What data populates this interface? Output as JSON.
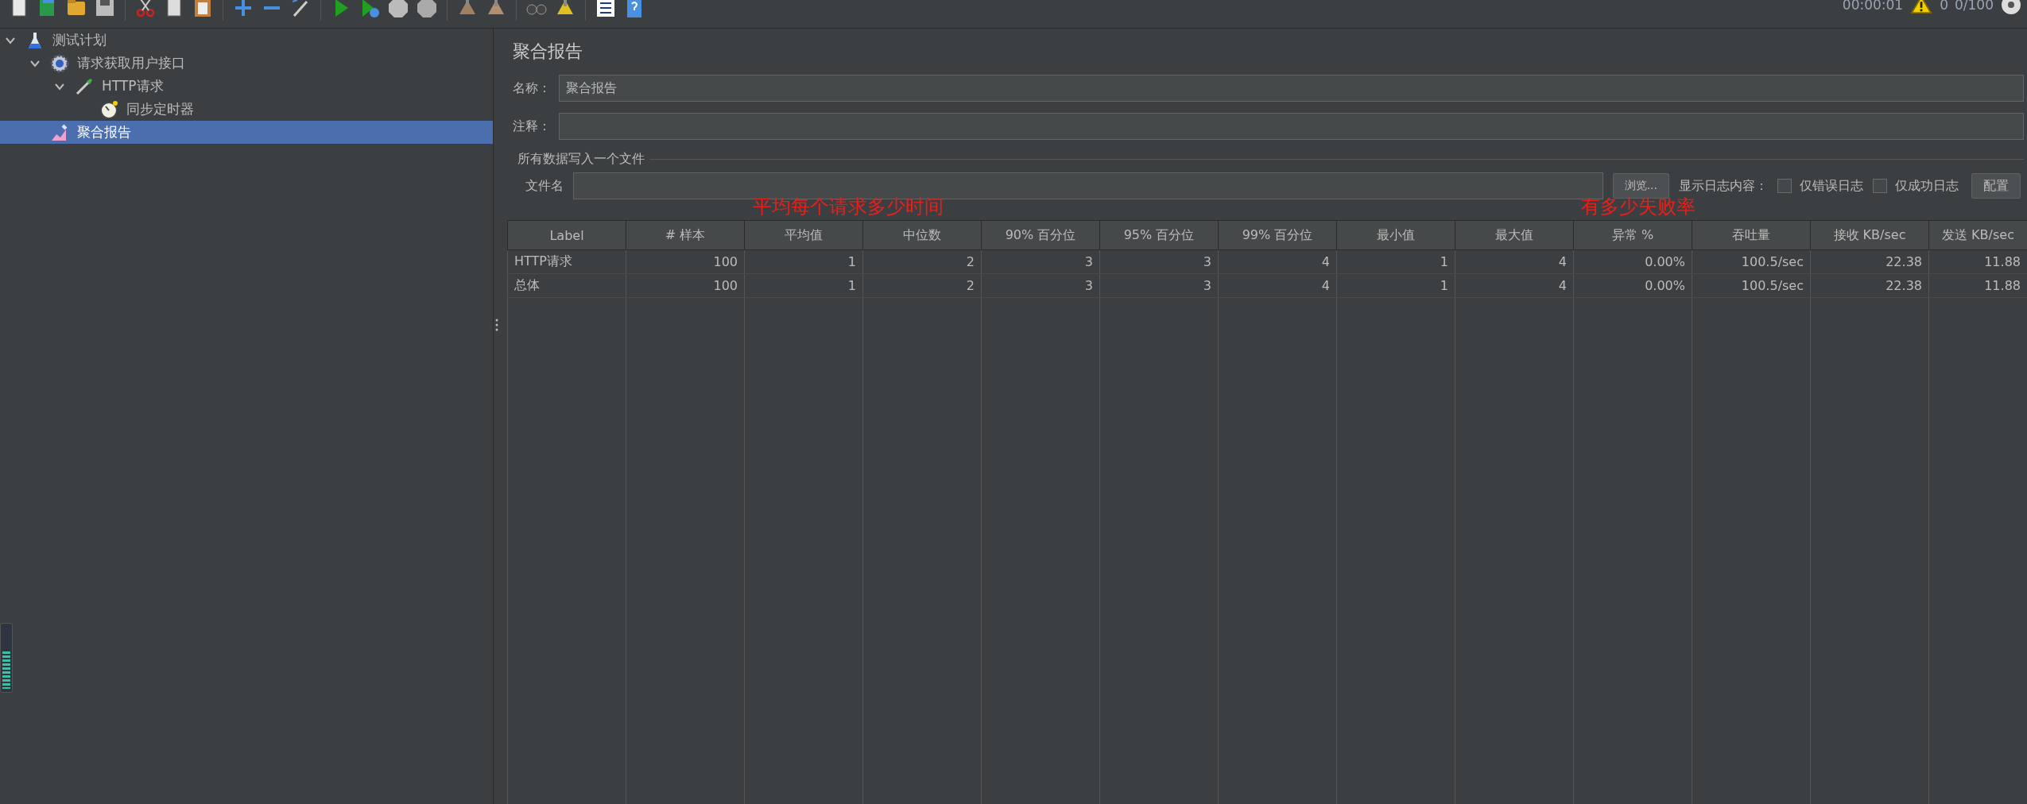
{
  "status": {
    "elapsed": "00:00:01",
    "warnings": "0",
    "threads": "0/100"
  },
  "tree": [
    {
      "label": "测试计划",
      "kind": "plan",
      "expanded": true,
      "selected": false,
      "children": [
        {
          "label": "请求获取用户接口",
          "kind": "group",
          "expanded": true,
          "selected": false,
          "children": [
            {
              "label": "HTTP请求",
              "kind": "sampler",
              "expanded": true,
              "selected": false,
              "children": [
                {
                  "label": "同步定时器",
                  "kind": "timer",
                  "selected": false
                }
              ]
            }
          ]
        },
        {
          "label": "聚合报告",
          "kind": "listener",
          "selected": true
        }
      ]
    }
  ],
  "memory_meter": {
    "level": 0.6
  },
  "panel": {
    "title": "聚合报告",
    "name_label": "名称：",
    "name_value": "聚合报告",
    "comment_label": "注释：",
    "file_section": "所有数据写入一个文件",
    "file_label": "文件名",
    "browse_button": "浏览...",
    "log_label": "显示日志内容：",
    "checkboxes": [
      {
        "label": "仅错误日志",
        "checked": false
      },
      {
        "label": "仅成功日志",
        "checked": false
      }
    ],
    "config_button": "配置"
  },
  "table": {
    "columns": [
      "Label",
      "# 样本",
      "平均值",
      "中位数",
      "90% 百分位",
      "95% 百分位",
      "99% 百分位",
      "最小值",
      "最大值",
      "异常 %",
      "吞吐量",
      "接收 KB/sec",
      "发送 KB/sec"
    ],
    "rows": [
      [
        "HTTP请求",
        "100",
        "1",
        "2",
        "3",
        "3",
        "4",
        "1",
        "4",
        "0.00%",
        "100.5/sec",
        "22.38",
        "11.88"
      ],
      [
        "总体",
        "100",
        "1",
        "2",
        "3",
        "3",
        "4",
        "1",
        "4",
        "0.00%",
        "100.5/sec",
        "22.38",
        "11.88"
      ]
    ]
  },
  "annotations": [
    "平均每个请求多少时间",
    "有多少失败率"
  ]
}
